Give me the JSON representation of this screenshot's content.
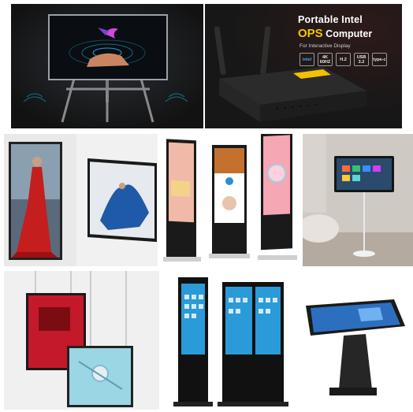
{
  "ops_ad": {
    "title_line1": "Portable Intel",
    "title_ops": "OPS",
    "title_rest": " Computer",
    "subtitle": "For Interactive Display",
    "badges": [
      "intel",
      "4K 60HZ",
      "H.2",
      "USB 3.2",
      "type-c"
    ]
  },
  "colors": {
    "ops_accent": "#f5c400",
    "dark_bg": "#1a1a1a"
  }
}
